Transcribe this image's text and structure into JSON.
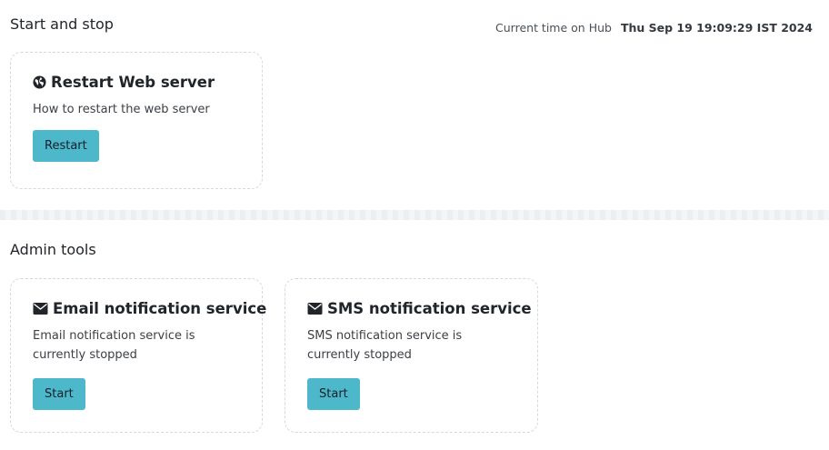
{
  "start_stop": {
    "heading": "Start and stop",
    "time_label": "Current time on Hub",
    "time_value": "Thu Sep 19 19:09:29 IST 2024",
    "restart_card": {
      "icon": "globe-icon",
      "title": "Restart Web server",
      "description": "How to restart the web server",
      "button_label": "Restart"
    }
  },
  "admin_tools": {
    "heading": "Admin tools",
    "email_card": {
      "icon": "envelope-icon",
      "title": "Email notification service",
      "description": "Email notification service is currently stopped",
      "button_label": "Start"
    },
    "sms_card": {
      "icon": "envelope-icon",
      "title": "SMS notification service",
      "description": "SMS notification service is currently stopped",
      "button_label": "Start"
    }
  },
  "colors": {
    "button_bg": "#4db8c9",
    "card_border": "#d6d9dc",
    "text": "#212529"
  }
}
